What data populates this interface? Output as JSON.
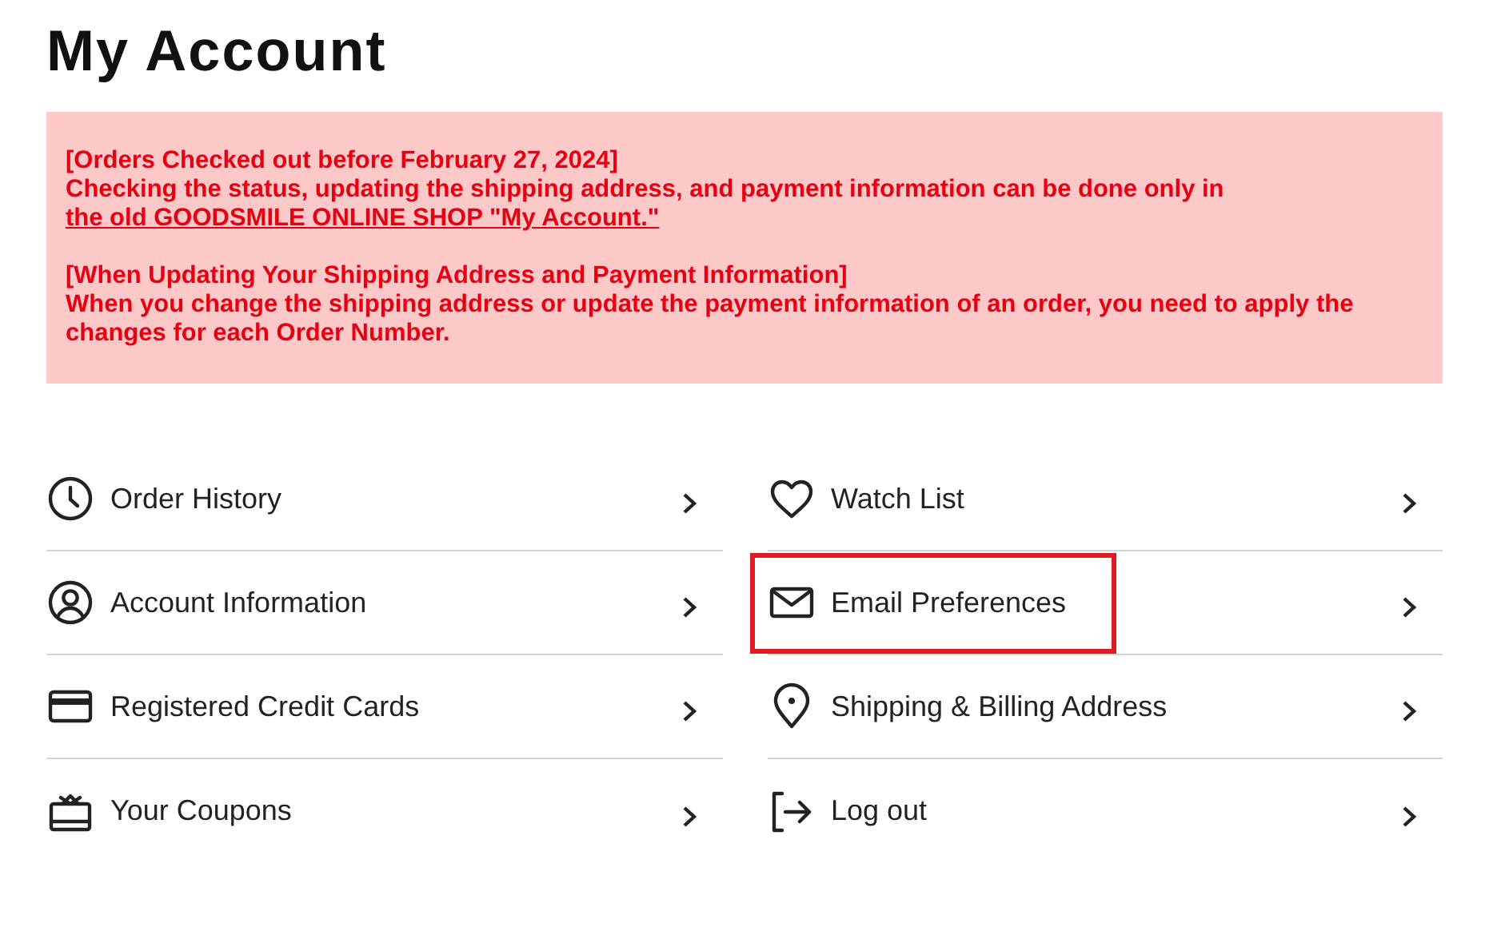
{
  "title": "My Account",
  "notice": [
    {
      "heading": "[Orders Checked out before February 27, 2024]",
      "text": "Checking the status, updating the shipping address, and payment information can be done only in",
      "link": "the old GOODSMILE ONLINE SHOP \"My Account.\""
    },
    {
      "heading": "[When Updating Your Shipping Address and Payment Information]",
      "text": "When you change the shipping address or update the payment information of an order, you need to apply the changes for each Order Number."
    }
  ],
  "menu_columns": [
    [
      {
        "label": "Order History",
        "highlighted": false
      },
      {
        "label": "Account Information",
        "highlighted": false
      },
      {
        "label": "Registered Credit Cards",
        "highlighted": false
      },
      {
        "label": "Your Coupons",
        "highlighted": false
      }
    ],
    [
      {
        "label": "Watch List",
        "highlighted": false
      },
      {
        "label": "Email Preferences",
        "highlighted": true
      },
      {
        "label": "Shipping & Billing Address",
        "highlighted": false
      },
      {
        "label": "Log out",
        "highlighted": false
      }
    ]
  ]
}
